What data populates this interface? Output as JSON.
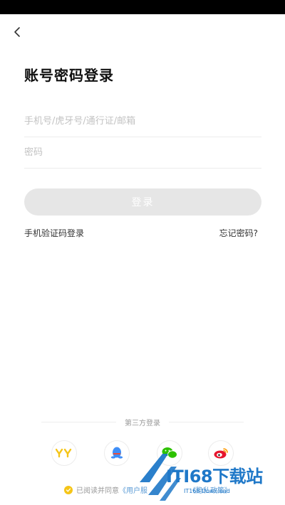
{
  "page": {
    "title": "账号密码登录",
    "account_placeholder": "手机号/虎牙号/通行证/邮箱",
    "password_placeholder": "密码",
    "login_label": "登录",
    "sms_login_label": "手机验证码登录",
    "forgot_password_label": "忘记密码?",
    "third_party_label": "第三方登录"
  },
  "agreement": {
    "prefix": "已阅读并同意",
    "terms": "《用户服",
    "privacy": "《隐私政策》"
  },
  "watermark": {
    "text": "ITI68下载站",
    "sub": "IT168 Download"
  },
  "colors": {
    "accent": "#f5c518",
    "button_disabled": "#e6e6e6",
    "link_blue": "#5b9bd5"
  },
  "icons": [
    "back-arrow-icon",
    "yy-icon",
    "qq-icon",
    "wechat-icon",
    "weibo-icon",
    "check-icon"
  ]
}
